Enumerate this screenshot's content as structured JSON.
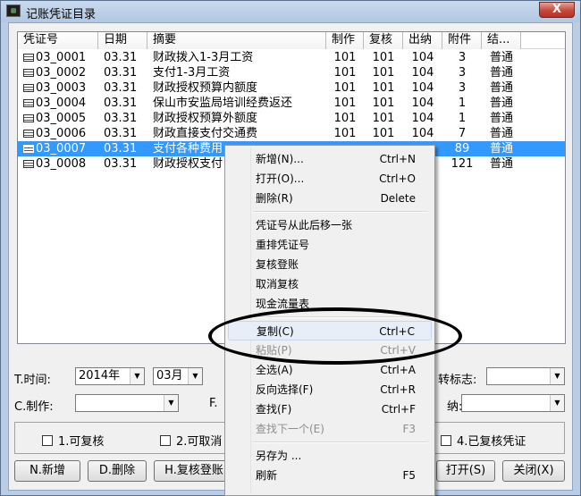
{
  "window": {
    "title": "记账凭证目录",
    "close_label": "X",
    "icon_text": "▤"
  },
  "list": {
    "columns": [
      {
        "label": "凭证号",
        "w": 90
      },
      {
        "label": "日期",
        "w": 55
      },
      {
        "label": "摘要",
        "w": 200
      },
      {
        "label": "制作",
        "w": 42
      },
      {
        "label": "复核",
        "w": 44
      },
      {
        "label": "出纳",
        "w": 44
      },
      {
        "label": "附件",
        "w": 44
      },
      {
        "label": "结...",
        "w": 44
      }
    ],
    "rows": [
      {
        "id": "03_0001",
        "date": "03.31",
        "summary": "财政拨入1-3月工资",
        "maker": "101",
        "reviewer": "101",
        "cashier": "104",
        "attach": "3",
        "status": "普通"
      },
      {
        "id": "03_0002",
        "date": "03.31",
        "summary": "支付1-3月工资",
        "maker": "101",
        "reviewer": "101",
        "cashier": "104",
        "attach": "3",
        "status": "普通"
      },
      {
        "id": "03_0003",
        "date": "03.31",
        "summary": "财政授权预算内额度",
        "maker": "101",
        "reviewer": "101",
        "cashier": "104",
        "attach": "3",
        "status": "普通"
      },
      {
        "id": "03_0004",
        "date": "03.31",
        "summary": "保山市安监局培训经费返还",
        "maker": "101",
        "reviewer": "101",
        "cashier": "104",
        "attach": "1",
        "status": "普通"
      },
      {
        "id": "03_0005",
        "date": "03.31",
        "summary": "财政授权预算外额度",
        "maker": "101",
        "reviewer": "101",
        "cashier": "104",
        "attach": "1",
        "status": "普通"
      },
      {
        "id": "03_0006",
        "date": "03.31",
        "summary": "财政直接支付交通费",
        "maker": "101",
        "reviewer": "101",
        "cashier": "104",
        "attach": "7",
        "status": "普通"
      },
      {
        "id": "03_0007",
        "date": "03.31",
        "summary": "支付各种费用",
        "maker": "",
        "reviewer": "",
        "cashier": "",
        "attach": "89",
        "status": "普通"
      },
      {
        "id": "03_0008",
        "date": "03.31",
        "summary": "财政授权支付",
        "maker": "",
        "reviewer": "",
        "cashier": "",
        "attach": "121",
        "status": "普通"
      }
    ],
    "selected_index": 6
  },
  "filters": {
    "time_label": "T.时间:",
    "year": "2014年",
    "month": "03月",
    "maker_label": "C.制作:",
    "maker_value": "",
    "f_label": "F.",
    "mark_label": "转标志:",
    "mark_value": "",
    "cashier_suffix": "纳:",
    "cashier_value": ""
  },
  "checks": [
    {
      "label": "1.可复核"
    },
    {
      "label": "2.可取消"
    },
    {
      "label": "4.已复核凭证"
    }
  ],
  "buttons": {
    "new": "N.新增",
    "delete": "D.删除",
    "review": "H.复核登账",
    "open": "打开(S)",
    "close": "关闭(X)"
  },
  "context_menu": {
    "groups": [
      [
        {
          "label": "新增(N)...",
          "shortcut": "Ctrl+N",
          "disabled": false
        },
        {
          "label": "打开(O)...",
          "shortcut": "Ctrl+O",
          "disabled": false
        },
        {
          "label": "删除(R)",
          "shortcut": "Delete",
          "disabled": false
        }
      ],
      [
        {
          "label": "凭证号从此后移一张",
          "shortcut": "",
          "disabled": false
        },
        {
          "label": "重排凭证号",
          "shortcut": "",
          "disabled": false
        },
        {
          "label": "复核登账",
          "shortcut": "",
          "disabled": false
        },
        {
          "label": "取消复核",
          "shortcut": "",
          "disabled": false
        },
        {
          "label": "现金流量表",
          "shortcut": "",
          "disabled": false
        }
      ],
      [
        {
          "label": "复制(C)",
          "shortcut": "Ctrl+C",
          "disabled": false,
          "highlighted": true
        },
        {
          "label": "粘贴(P)",
          "shortcut": "Ctrl+V",
          "disabled": true
        },
        {
          "label": "全选(A)",
          "shortcut": "Ctrl+A",
          "disabled": false
        },
        {
          "label": "反向选择(F)",
          "shortcut": "Ctrl+R",
          "disabled": false
        },
        {
          "label": "查找(F)",
          "shortcut": "Ctrl+F",
          "disabled": false
        },
        {
          "label": "查找下一个(E)",
          "shortcut": "F3",
          "disabled": true
        }
      ],
      [
        {
          "label": "另存为 ...",
          "shortcut": "",
          "disabled": false
        },
        {
          "label": "刷新",
          "shortcut": "F5",
          "disabled": false
        }
      ]
    ]
  }
}
